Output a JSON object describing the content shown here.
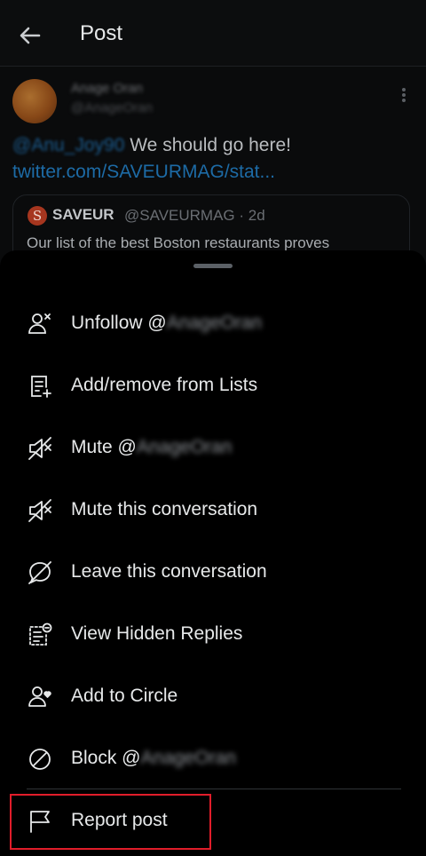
{
  "header": {
    "title": "Post"
  },
  "post": {
    "author_name": "Anage Oran",
    "author_handle": "@AnageOran",
    "mention": "@Anu_Joy90",
    "text": " We should go here!",
    "link": "twitter.com/SAVEURMAG/stat...",
    "quote": {
      "logo_letter": "S",
      "name": "SAVEUR",
      "handle": "@SAVEURMAG · 2d",
      "text": "Our list of the best Boston restaurants proves"
    }
  },
  "menu": {
    "unfollow": {
      "label": "Unfollow @",
      "name": "AnageOran",
      "icon": "unfollow-user-icon"
    },
    "lists": {
      "label": "Add/remove from Lists",
      "icon": "list-add-icon"
    },
    "mute_user": {
      "label": "Mute @",
      "name": "AnageOran",
      "icon": "mute-speaker-icon"
    },
    "mute_conversation": {
      "label": "Mute this conversation",
      "icon": "mute-speaker-icon"
    },
    "leave_conversation": {
      "label": "Leave this conversation",
      "icon": "bubble-slash-icon"
    },
    "hidden_replies": {
      "label": "View Hidden Replies",
      "icon": "hidden-replies-icon"
    },
    "circle": {
      "label": "Add to Circle",
      "icon": "user-heart-icon"
    },
    "block": {
      "label": "Block @",
      "name": "AnageOran",
      "icon": "block-icon"
    },
    "report": {
      "label": "Report post",
      "icon": "flag-icon"
    }
  },
  "colors": {
    "background": "#000000",
    "text": "#e7e9ea",
    "link": "#1d9bf0",
    "highlight": "#e11d2a"
  }
}
